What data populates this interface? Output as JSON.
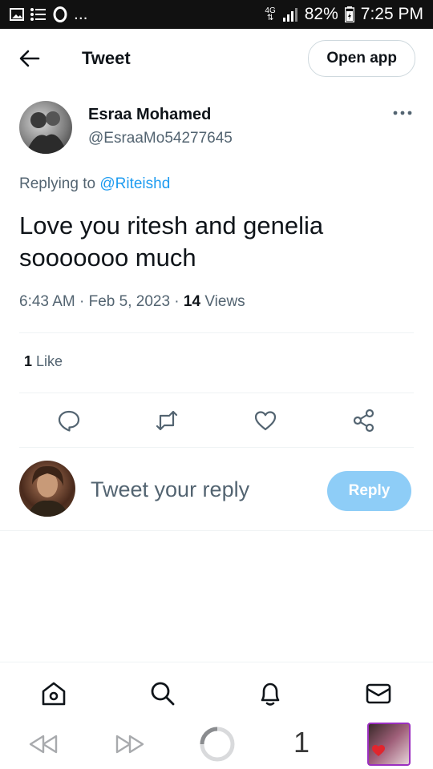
{
  "status_bar": {
    "network": "4G",
    "battery": "82%",
    "time": "7:25 PM",
    "more": "..."
  },
  "header": {
    "title": "Tweet",
    "open_app_label": "Open app"
  },
  "tweet": {
    "author_name": "Esraa Mohamed",
    "author_handle": "@EsraaMo54277645",
    "replying_prefix": "Replying to",
    "replying_handle": "@Riteishd",
    "text": "Love you ritesh and genelia sooooooo much",
    "time": "6:43 AM",
    "date": "Feb 5, 2023",
    "views_count": "14",
    "views_label": "Views",
    "likes_count": "1",
    "likes_label": "Like"
  },
  "reply": {
    "placeholder": "Tweet your reply",
    "button_label": "Reply"
  },
  "browser": {
    "tab_count": "1"
  },
  "icons": [
    "back-arrow-icon",
    "more-icon",
    "reply-icon",
    "retweet-icon",
    "like-icon",
    "share-icon",
    "home-icon",
    "search-icon",
    "notifications-icon",
    "messages-icon",
    "rewind-icon",
    "forward-icon",
    "loading-icon"
  ]
}
